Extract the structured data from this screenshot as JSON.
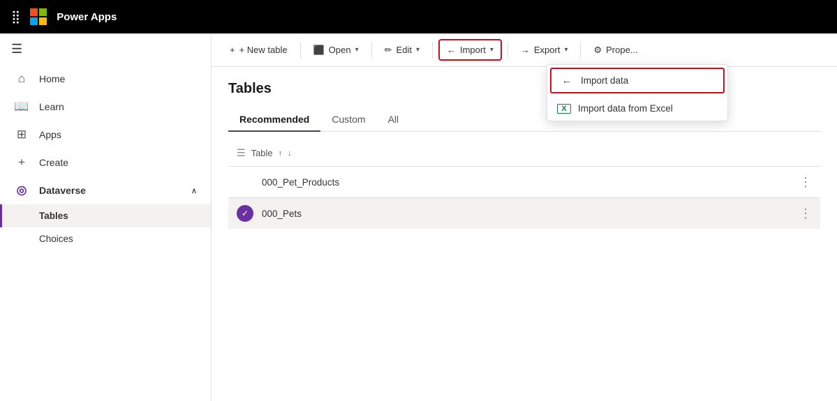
{
  "topbar": {
    "brand": "Power Apps",
    "microsoft": "Microsoft"
  },
  "sidebar": {
    "hamburger_icon": "☰",
    "items": [
      {
        "id": "home",
        "label": "Home",
        "icon": "⌂"
      },
      {
        "id": "learn",
        "label": "Learn",
        "icon": "📖"
      },
      {
        "id": "apps",
        "label": "Apps",
        "icon": "⊞"
      },
      {
        "id": "create",
        "label": "Create",
        "icon": "+"
      },
      {
        "id": "dataverse",
        "label": "Dataverse",
        "icon": "◎",
        "expanded": true,
        "chevron": "∧"
      }
    ],
    "sub_items": [
      {
        "id": "tables",
        "label": "Tables",
        "active": true
      },
      {
        "id": "choices",
        "label": "Choices"
      }
    ]
  },
  "toolbar": {
    "new_table_label": "+ New table",
    "open_label": "Open",
    "edit_label": "Edit",
    "import_label": "Import",
    "export_label": "Export",
    "properties_label": "Prope..."
  },
  "page": {
    "title": "Tables",
    "tabs": [
      {
        "id": "recommended",
        "label": "Recommended",
        "active": true
      },
      {
        "id": "custom",
        "label": "Custom"
      },
      {
        "id": "all",
        "label": "All"
      }
    ],
    "table_col_label": "Table",
    "rows": [
      {
        "id": "row1",
        "name": "000_Pet_Products",
        "selected": false
      },
      {
        "id": "row2",
        "name": "000_Pets",
        "selected": true
      }
    ]
  },
  "dropdown": {
    "items": [
      {
        "id": "import-data",
        "label": "Import data",
        "icon": "←",
        "highlighted": true
      },
      {
        "id": "import-excel",
        "label": "Import data from Excel",
        "icon": "X"
      }
    ]
  }
}
